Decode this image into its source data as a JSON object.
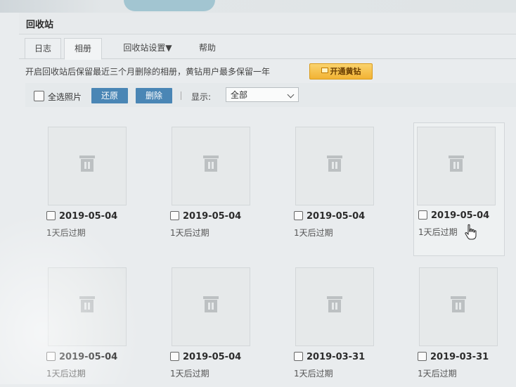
{
  "header": {
    "title": "回收站"
  },
  "tabs": [
    {
      "label": "日志"
    },
    {
      "label": "相册"
    },
    {
      "label": "回收站设置▼"
    },
    {
      "label": "帮助"
    }
  ],
  "notice": {
    "text": "开启回收站后保留最近三个月删除的相册，黄钻用户最多保留一年",
    "vip_label": "开通黄钻"
  },
  "toolbar": {
    "select_all_label": "全选照片",
    "restore_label": "还原",
    "delete_label": "删除",
    "show_label": "显示:",
    "filter_value": "全部"
  },
  "photos": [
    {
      "date": "2019-05-04",
      "expires": "1天后过期"
    },
    {
      "date": "2019-05-04",
      "expires": "1天后过期"
    },
    {
      "date": "2019-05-04",
      "expires": "1天后过期"
    },
    {
      "date": "2019-05-04",
      "expires": "1天后过期"
    },
    {
      "date": "2019-05-04",
      "expires": "1天后过期"
    },
    {
      "date": "2019-05-04",
      "expires": "1天后过期"
    },
    {
      "date": "2019-03-31",
      "expires": "1天后过期"
    },
    {
      "date": "2019-03-31",
      "expires": "1天后过期"
    }
  ],
  "colors": {
    "accent_button": "#4a86b5",
    "vip_gold": "#f2b334"
  }
}
